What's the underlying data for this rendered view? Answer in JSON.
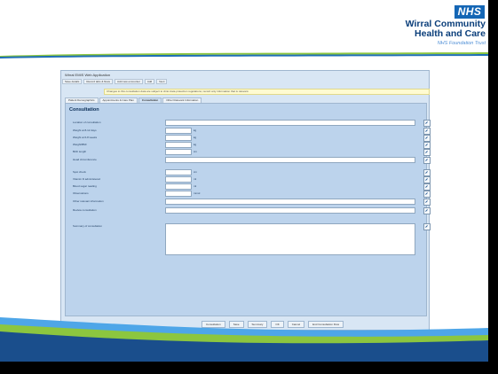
{
  "header": {
    "logo_text": "NHS",
    "org_line1": "Wirral Community",
    "org_line2": "Health and Care",
    "org_subtitle": "NHS Foundation Trust"
  },
  "window": {
    "title": "Wirral EMIS Web Application",
    "toolbar": [
      "Save details",
      "Record tabs & flows",
      "Add new encounter",
      "Add",
      "Next"
    ],
    "notice": "Changes to this consultation data are subject to clinic data protection regulations; record only information that is relevant.",
    "tabs": [
      "Patient Demographics",
      "Appointments & Care Plan",
      "Consultation",
      "Other Relevant Information"
    ],
    "active_tab_index": 2,
    "panel_title": "Consultation",
    "fields": [
      {
        "label": "Location of consultation",
        "width": "full"
      },
      {
        "label": "Weight at 8-12 days",
        "unit": "kg"
      },
      {
        "label": "Weight at 6-8 weeks",
        "unit": "kg"
      },
      {
        "label": "Weight/BMI",
        "unit": "kg"
      },
      {
        "label": "Birth length",
        "unit": "cm"
      },
      {
        "label": "Head circumference",
        "width": "full"
      },
      {
        "label": "Spot check",
        "unit": "cm"
      },
      {
        "label": "Vitamin D administered",
        "unit": "ml"
      },
      {
        "label": "Blood sugar reading",
        "unit": "ml"
      },
      {
        "label": "Observations",
        "unit": "mmol"
      },
      {
        "label": "Other relevant information",
        "width": "full"
      },
      {
        "label": "Review consultation",
        "width": "full"
      },
      {
        "label": "Summary of consultation",
        "width": "area"
      }
    ],
    "footer_buttons": [
      "Consultation",
      "Save",
      "Summary",
      "OK",
      "Cancel",
      "End Consultation Flow"
    ]
  },
  "colors": {
    "nhs_blue": "#1466b5",
    "org_navy": "#0a3e7a",
    "panel_blue": "#bcd3ec",
    "wave_blue": "#1e6fb5",
    "wave_green": "#8cc63f"
  }
}
